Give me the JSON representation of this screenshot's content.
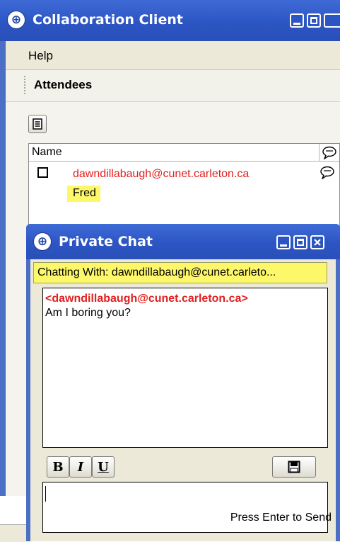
{
  "main_window": {
    "title": "Collaboration Client",
    "menu": {
      "help_label": "Help"
    },
    "panel_title": "Attendees",
    "list": {
      "column_name": "Name",
      "attendees": [
        {
          "email": "dawndillabaugh@cunet.carleton.ca",
          "name": "Fred"
        }
      ]
    }
  },
  "private_chat": {
    "title": "Private Chat",
    "chatting_with": "Chatting With: dawndillabaugh@cunet.carleto...",
    "messages": [
      {
        "sender": "<dawndillabaugh@cunet.carleton.ca>",
        "text": "Am I boring you?"
      }
    ],
    "format_buttons": {
      "bold": "B",
      "italic": "I",
      "underline": "U"
    },
    "input_value": "",
    "hint": "Press Enter to Send"
  },
  "colors": {
    "title_bar": "#2c55c4",
    "highlight": "#fdf86a",
    "sender": "#e22020"
  }
}
